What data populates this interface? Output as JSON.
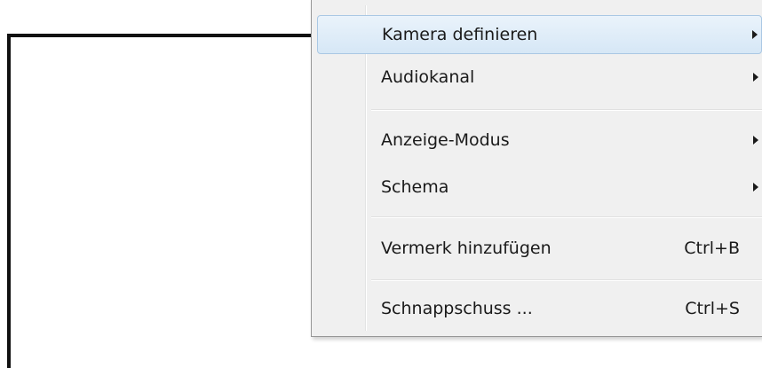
{
  "menu": {
    "items": [
      {
        "label": "Kamera definieren",
        "shortcut": "",
        "submenu": true,
        "highlighted": true
      },
      {
        "label": "Audiokanal",
        "shortcut": "",
        "submenu": true
      },
      {
        "label": "Anzeige-Modus",
        "shortcut": "",
        "submenu": true
      },
      {
        "label": "Schema",
        "shortcut": "",
        "submenu": true
      },
      {
        "label": "Vermerk hinzufügen",
        "shortcut": "Ctrl+B",
        "submenu": false
      },
      {
        "label": "Schnappschuss ...",
        "shortcut": "Ctrl+S",
        "submenu": false
      }
    ]
  },
  "icons": {
    "submenu": "submenu-arrow-icon"
  },
  "colors": {
    "menu_bg": "#f0f0f0",
    "highlight": "#d6e7f6",
    "callout_line": "#111111"
  }
}
